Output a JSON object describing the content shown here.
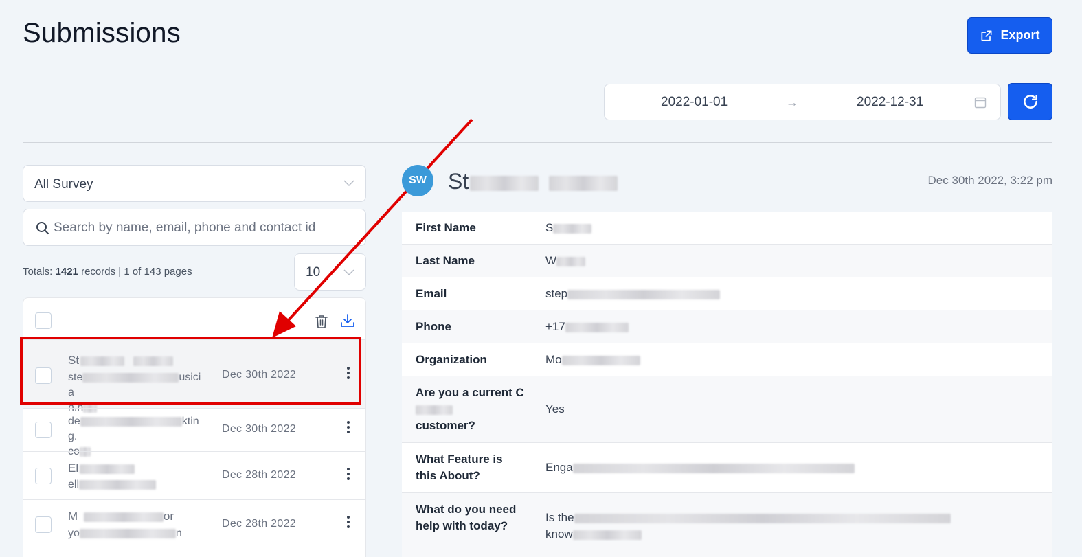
{
  "page": {
    "title": "Submissions"
  },
  "toolbar": {
    "export_label": "Export"
  },
  "date_range": {
    "start": "2022-01-01",
    "end": "2022-12-31"
  },
  "filters": {
    "survey_selected": "All Survey",
    "search_placeholder": "Search by name, email, phone and contact id",
    "page_size": "10"
  },
  "totals": {
    "prefix": "Totals: ",
    "records": "1421",
    "suffix": " records | 1 of 143 pages"
  },
  "submissions": [
    {
      "name": "St",
      "email": "ste",
      "email_tail": "usicia",
      "email_line2": "n.n",
      "date": "Dec 30th 2022"
    },
    {
      "name": "",
      "email": "de",
      "email_tail": "kting.",
      "email_line2": "co",
      "date": "Dec 30th 2022"
    },
    {
      "name": "El",
      "email": "ell",
      "email_tail": "",
      "email_line2": "",
      "date": "Dec 28th 2022"
    },
    {
      "name": "M",
      "name_tail": "or",
      "email": "yo",
      "email_tail": "n",
      "email_line2": "",
      "date": "Dec 28th 2022"
    }
  ],
  "detail": {
    "initials": "SW",
    "name": "St",
    "submitted_at": "Dec 30th 2022, 3:22 pm",
    "fields": [
      {
        "label": "First Name",
        "value": "S"
      },
      {
        "label": "Last Name",
        "value": "W"
      },
      {
        "label": "Email",
        "value": "step"
      },
      {
        "label": "Phone",
        "value": "+17"
      },
      {
        "label": "Organization",
        "value": "Mo"
      },
      {
        "label": "Are you a current C",
        "label_tail": "customer?",
        "value": "Yes"
      },
      {
        "label": "What Feature is this About?",
        "value": "Enga"
      },
      {
        "label": "What do you need help with today?",
        "value": "Is the",
        "value_line2": "know"
      }
    ]
  },
  "icons": {
    "export": "export-icon",
    "refresh": "refresh-icon",
    "calendar": "calendar-icon",
    "search": "search-icon",
    "trash": "trash-icon",
    "download": "download-icon",
    "kebab": "kebab-menu-icon"
  },
  "colors": {
    "primary": "#155eef",
    "annotation": "#e00000",
    "avatar": "#3b9ad9",
    "background": "#f1f5f9"
  }
}
